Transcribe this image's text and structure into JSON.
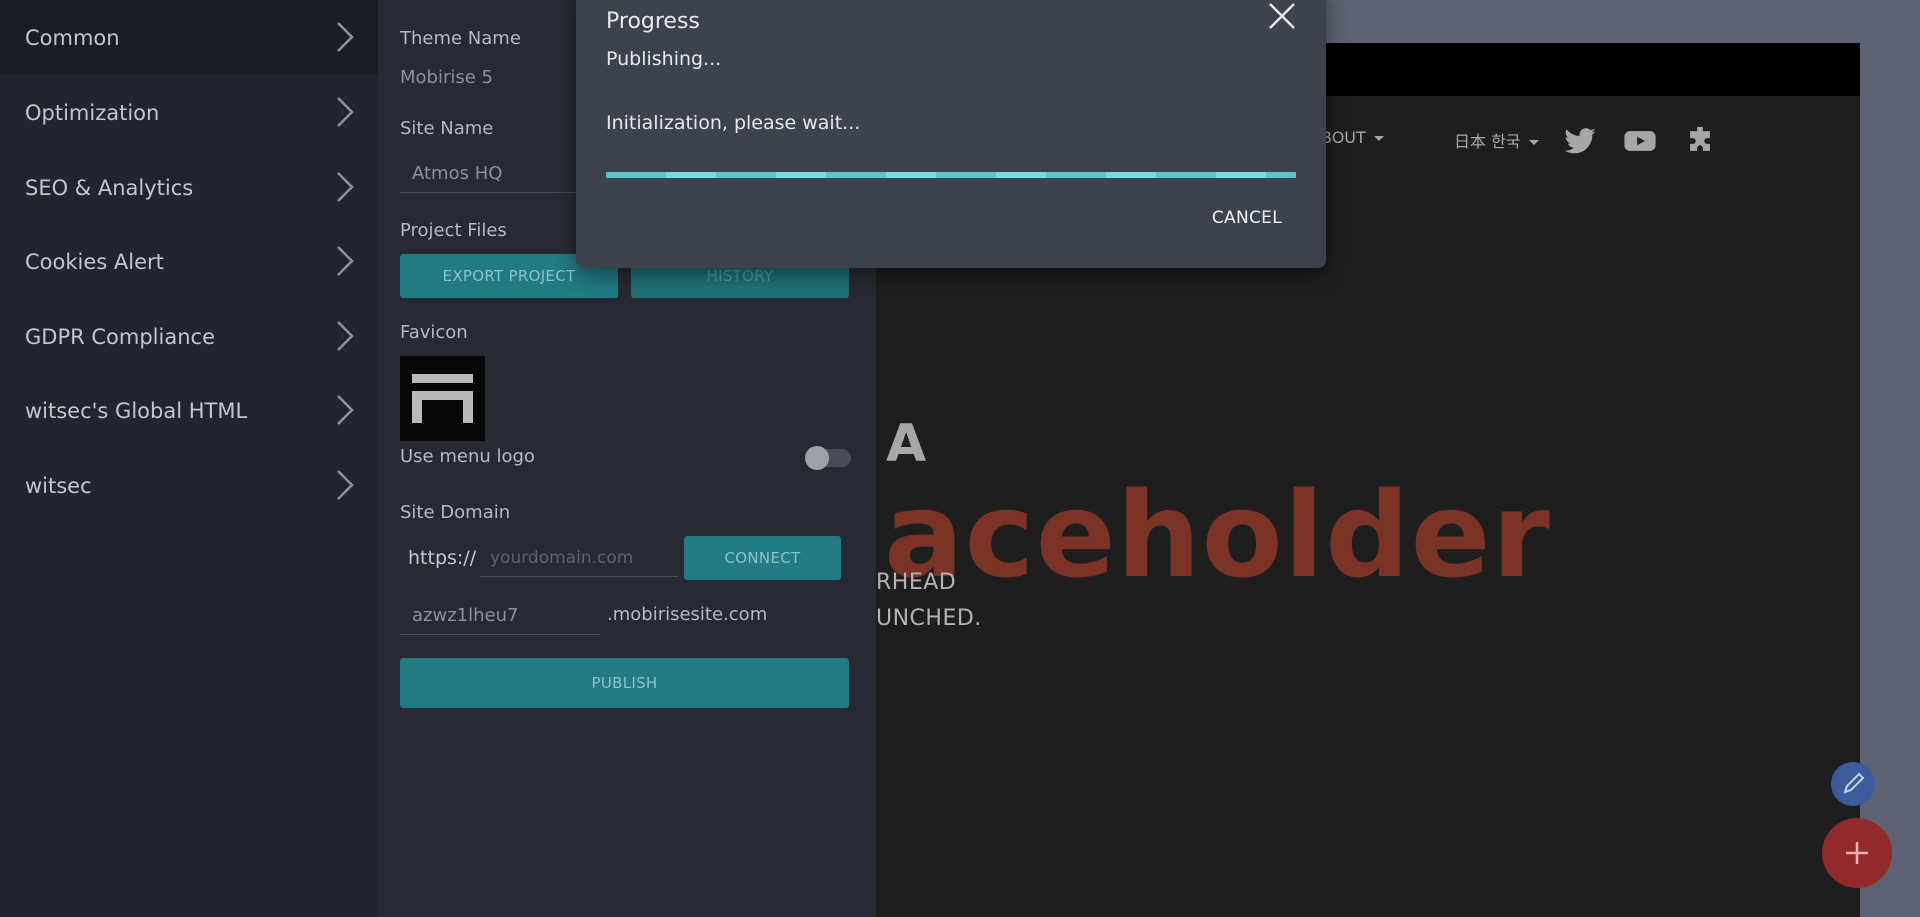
{
  "sidebar": {
    "items": [
      {
        "label": "Common"
      },
      {
        "label": "Optimization"
      },
      {
        "label": "SEO & Analytics"
      },
      {
        "label": "Cookies Alert"
      },
      {
        "label": "GDPR Compliance"
      },
      {
        "label": "witsec's Global HTML"
      },
      {
        "label": "witsec"
      }
    ],
    "chevron_icon": "chevron-right-icon"
  },
  "panel": {
    "theme_name_label": "Theme Name",
    "theme_name_value": "Mobirise 5",
    "site_name_label": "Site Name",
    "site_name_value": "Atmos HQ",
    "project_files_label": "Project Files",
    "export_button": "EXPORT PROJECT",
    "history_button": "HISTORY",
    "favicon_label": "Favicon",
    "use_menu_logo_label": "Use menu logo",
    "use_menu_logo_on": false,
    "site_domain_label": "Site Domain",
    "domain_prefix": "https://",
    "domain_placeholder": "yourdomain.com",
    "connect_button": "CONNECT",
    "subdomain_value": "azwz1lheu7",
    "subdomain_suffix": ".mobirisesite.com",
    "publish_button": "PUBLISH"
  },
  "preview": {
    "menu_about": "BOUT",
    "menu_lang": "日本 한국",
    "icons": [
      "twitter-icon",
      "youtube-icon",
      "puzzle-icon"
    ],
    "hero_a": "A",
    "hero_big": "aceholder",
    "hero_sub1": "RHEAD",
    "hero_sub2": "UNCHED.",
    "edit_icon": "pencil-icon",
    "add_icon": "plus-icon"
  },
  "dialog": {
    "title": "Progress",
    "status": "Publishing...",
    "message": "Initialization, please wait...",
    "progress_fraction": 1.0,
    "cancel_button": "CANCEL",
    "close_icon": "close-icon"
  },
  "colors": {
    "accent": "#227a82",
    "progress": "#58c5cf",
    "hero_red": "#7a3324",
    "fab_red": "#922a2c",
    "fab_blue": "#3c5b9b"
  }
}
